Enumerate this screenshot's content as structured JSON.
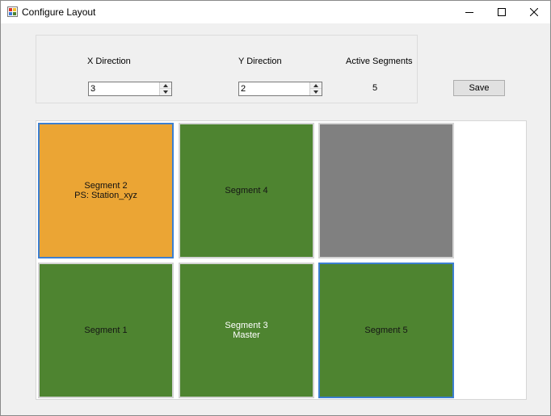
{
  "window": {
    "title": "Configure Layout",
    "icons": {
      "app": "layout-app-icon",
      "minimize": "minimize-icon",
      "maximize": "maximize-icon",
      "close": "close-icon"
    }
  },
  "settings": {
    "x_direction": {
      "label": "X Direction",
      "value": "3"
    },
    "y_direction": {
      "label": "Y Direction",
      "value": "2"
    },
    "active_segments": {
      "label": "Active Segments",
      "value": "5"
    },
    "save_label": "Save"
  },
  "colors": {
    "segment_green": "#4e8430",
    "segment_orange": "#eba534",
    "segment_empty": "#808080",
    "selected_border": "#3d7fd0"
  },
  "segments": [
    {
      "line1": "Segment 2",
      "line2": "PS: Station_xyz",
      "color": "#eba534",
      "selected": true
    },
    {
      "line1": "Segment 4",
      "line2": "",
      "color": "#4e8430",
      "selected": false
    },
    {
      "line1": "",
      "line2": "",
      "color": "#808080",
      "selected": false
    },
    {
      "line1": "Segment 1",
      "line2": "",
      "color": "#4e8430",
      "selected": false
    },
    {
      "line1": "Segment 3",
      "line2": "Master",
      "color": "#4e8430",
      "selected": false
    },
    {
      "line1": "Segment 5",
      "line2": "",
      "color": "#4e8430",
      "selected": true
    }
  ]
}
